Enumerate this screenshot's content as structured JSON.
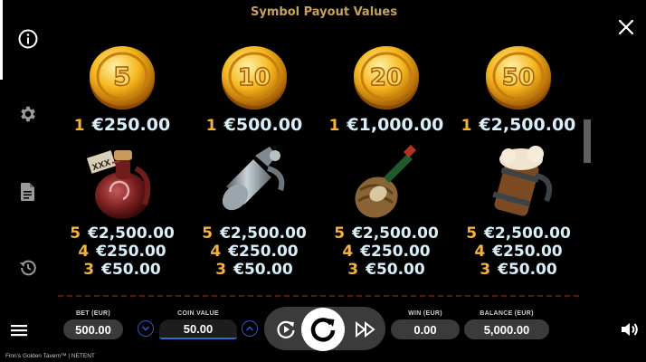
{
  "panel": {
    "title": "Symbol Payout Values",
    "symbols": [
      {
        "icon": "coin-5-icon",
        "coin_text": "5",
        "payouts": [
          {
            "count": "1",
            "amount": "€250.00"
          }
        ]
      },
      {
        "icon": "coin-10-icon",
        "coin_text": "10",
        "payouts": [
          {
            "count": "1",
            "amount": "€500.00"
          }
        ]
      },
      {
        "icon": "coin-20-icon",
        "coin_text": "20",
        "payouts": [
          {
            "count": "1",
            "amount": "€1,000.00"
          }
        ]
      },
      {
        "icon": "coin-50-icon",
        "coin_text": "50",
        "payouts": [
          {
            "count": "1",
            "amount": "€2,500.00"
          }
        ]
      },
      {
        "icon": "potion-jug-icon",
        "label_text": "XXX",
        "payouts": [
          {
            "count": "5",
            "amount": "€2,500.00"
          },
          {
            "count": "4",
            "amount": "€250.00"
          },
          {
            "count": "3",
            "amount": "€50.00"
          }
        ]
      },
      {
        "icon": "pewter-jug-icon",
        "payouts": [
          {
            "count": "5",
            "amount": "€2,500.00"
          },
          {
            "count": "4",
            "amount": "€250.00"
          },
          {
            "count": "3",
            "amount": "€50.00"
          }
        ]
      },
      {
        "icon": "wine-bottle-icon",
        "payouts": [
          {
            "count": "5",
            "amount": "€2,500.00"
          },
          {
            "count": "4",
            "amount": "€250.00"
          },
          {
            "count": "3",
            "amount": "€50.00"
          }
        ]
      },
      {
        "icon": "beer-tankard-icon",
        "payouts": [
          {
            "count": "5",
            "amount": "€2,500.00"
          },
          {
            "count": "4",
            "amount": "€250.00"
          },
          {
            "count": "3",
            "amount": "€50.00"
          }
        ]
      }
    ]
  },
  "sidebar": {
    "items": [
      {
        "icon": "info-icon",
        "active": true
      },
      {
        "icon": "gear-icon",
        "active": false
      },
      {
        "icon": "document-icon",
        "active": false
      },
      {
        "icon": "history-icon",
        "active": false
      }
    ]
  },
  "bottom_bar": {
    "bet": {
      "label": "BET (EUR)",
      "value": "500.00"
    },
    "coin_value": {
      "label": "COIN VALUE",
      "value": "50.00"
    },
    "win": {
      "label": "WIN (EUR)",
      "value": "0.00"
    },
    "balance": {
      "label": "BALANCE (EUR)",
      "value": "5,000.00"
    }
  },
  "footer": {
    "game_title": "Finn's Golden Tavern™ | NETENT"
  },
  "colors": {
    "accent_gold": "#f2b23b",
    "payout_amount": "#d8eef9",
    "title_gold": "#c8a15a",
    "stepper_blue": "#2e55c8"
  }
}
